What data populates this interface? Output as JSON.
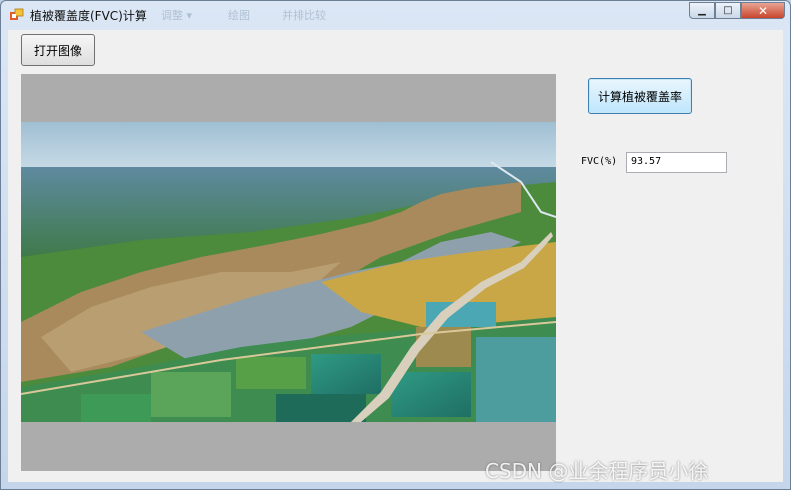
{
  "window": {
    "title": "植被覆盖度(FVC)计算",
    "ghost_menu": [
      "调整 ▾",
      "绘图",
      "并排比较"
    ],
    "controls": {
      "minimize": "▁",
      "maximize": "□",
      "close": "✕"
    }
  },
  "buttons": {
    "open_image": "打开图像",
    "compute": "计算植被覆盖率"
  },
  "fvc": {
    "label": "FVC(%)",
    "value": "93.57"
  },
  "watermark": "CSDN @业余程序员小徐",
  "colors": {
    "client_bg": "#f0f0f0",
    "picturebox_bg": "#acacac",
    "button_focus_border": "#3c7fb1"
  }
}
